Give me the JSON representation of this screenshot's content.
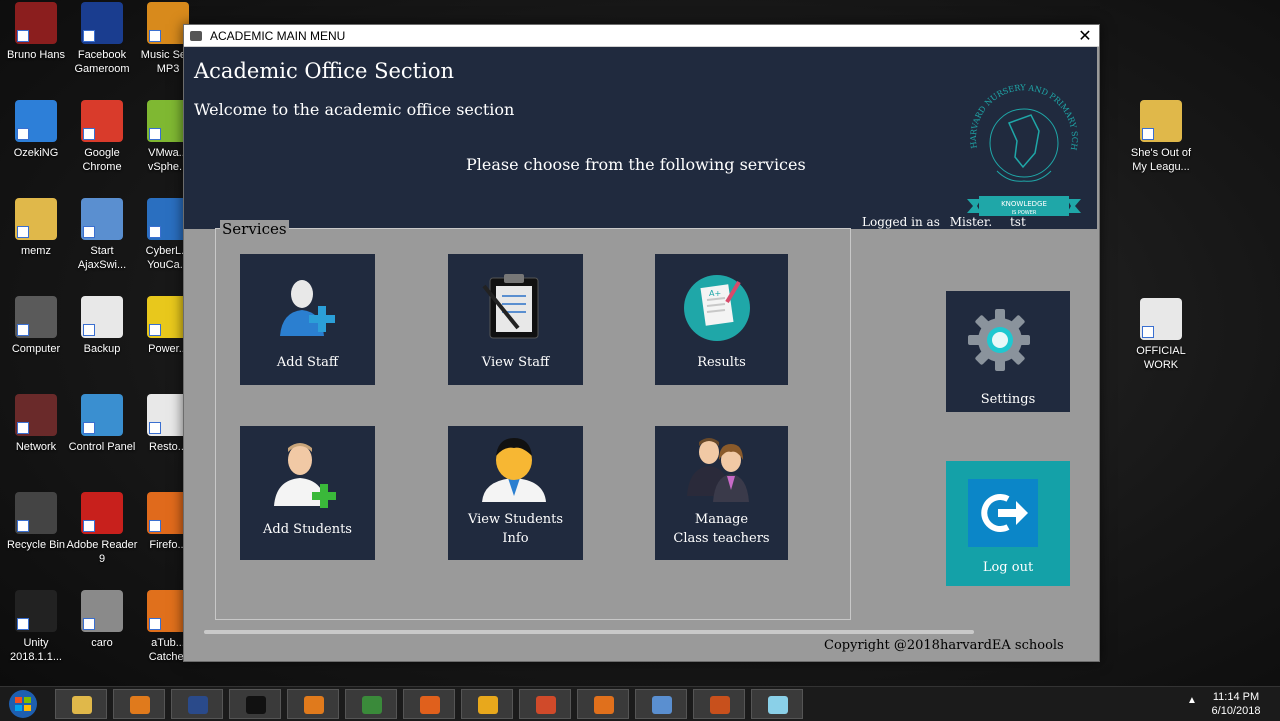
{
  "desktop": {
    "icons_left": [
      {
        "label": "Bruno Hans",
        "icon": "assassin-icon",
        "color": "#8b1e1e"
      },
      {
        "label": "Facebook Gameroom",
        "icon": "facebook-gameroom-icon",
        "color": "#1a3d8f"
      },
      {
        "label": "Music Se... MP3",
        "icon": "music-search-icon",
        "color": "#d88a1c"
      },
      {
        "label": "OzekiNG",
        "icon": "ozeki-icon",
        "color": "#2d7fd8"
      },
      {
        "label": "Google Chrome",
        "icon": "chrome-icon",
        "color": "#d93b2b"
      },
      {
        "label": "VMwa... vSphe...",
        "icon": "vmware-icon",
        "color": "#7fb832"
      },
      {
        "label": "memz",
        "icon": "folder-icon",
        "color": "#e0b84a"
      },
      {
        "label": "Start AjaxSwi...",
        "icon": "ajaxswitch-icon",
        "color": "#5a8fd0"
      },
      {
        "label": "CyberL... YouCa...",
        "icon": "youcam-icon",
        "color": "#2a6fc0"
      },
      {
        "label": "Computer",
        "icon": "assassin-icon",
        "color": "#5a5a5a"
      },
      {
        "label": "Backup",
        "icon": "document-icon",
        "color": "#e8e8e8"
      },
      {
        "label": "Power...",
        "icon": "power-dvd-icon",
        "color": "#e8c81c"
      },
      {
        "label": "Network",
        "icon": "assassin-icon",
        "color": "#6a2a2a"
      },
      {
        "label": "Control Panel",
        "icon": "control-panel-icon",
        "color": "#3a8fd0"
      },
      {
        "label": "Resto...",
        "icon": "document-icon",
        "color": "#e8e8e8"
      },
      {
        "label": "Recycle Bin",
        "icon": "recycle-bin-icon",
        "color": "#444444"
      },
      {
        "label": "Adobe Reader 9",
        "icon": "adobe-reader-icon",
        "color": "#c8201c"
      },
      {
        "label": "Firefo...",
        "icon": "firefox-icon",
        "color": "#e06a1c"
      },
      {
        "label": "Unity 2018.1.1...",
        "icon": "unity-icon",
        "color": "#222222"
      },
      {
        "label": "caro",
        "icon": "caro-icon",
        "color": "#8a8a8a"
      },
      {
        "label": "aTub... Catcher",
        "icon": "atube-icon",
        "color": "#e0701c"
      }
    ],
    "icons_right": [
      {
        "label": "She's Out of My Leagu...",
        "icon": "folder-icon",
        "color": "#e0b84a"
      },
      {
        "label": "OFFICIAL WORK",
        "icon": "word-document-icon",
        "color": "#e8e8e8"
      }
    ]
  },
  "window": {
    "title": "ACADEMIC MAIN MENU",
    "close_symbol": "✕",
    "header": {
      "title": "Academic Office Section",
      "welcome": "Welcome to the academic office section",
      "choose": "Please choose from the following services",
      "logo_text": {
        "arc": "HARVARD NURSERY AND PRIMARY SCHOOL",
        "banner_top": "KNOWLEDGE",
        "banner_bottom": "IS POWER"
      }
    },
    "services_label": "Services",
    "tiles": [
      {
        "label": "Add Staff",
        "icon": "add-staff-icon"
      },
      {
        "label": "View Staff",
        "icon": "clipboard-icon"
      },
      {
        "label": "Results",
        "icon": "results-icon"
      },
      {
        "label": "Add Students",
        "icon": "add-student-icon"
      },
      {
        "label": "View Students Info",
        "line1": "View Students",
        "line2": "Info",
        "icon": "student-avatar-icon"
      },
      {
        "label": "Manage Class teachers",
        "line1": "Manage",
        "line2": "Class teachers",
        "icon": "teachers-icon"
      }
    ],
    "logged_in": {
      "prefix": "Logged in as",
      "user": "Mister.",
      "extra": "tst"
    },
    "settings_label": "Settings",
    "logout_label": "Log out",
    "copyright": "Copyright @2018harvardEA schools",
    "colors": {
      "header": "#202a3e",
      "tile": "#202a3e",
      "logout": "#14a1a8",
      "window_bg": "#9a9a9a",
      "logo_teal": "#1fa7a8"
    }
  },
  "taskbar": {
    "apps": [
      "file-explorer-icon",
      "media-player-icon",
      "mysql-icon",
      "cmd-icon",
      "vlc-icon",
      "network-icon",
      "firefox-icon",
      "sublime-icon",
      "powerpoint-icon",
      "atube-icon",
      "virtualbox-icon",
      "java-icon",
      "app-icon"
    ],
    "time": "11:14 PM",
    "date": "6/10/2018"
  }
}
